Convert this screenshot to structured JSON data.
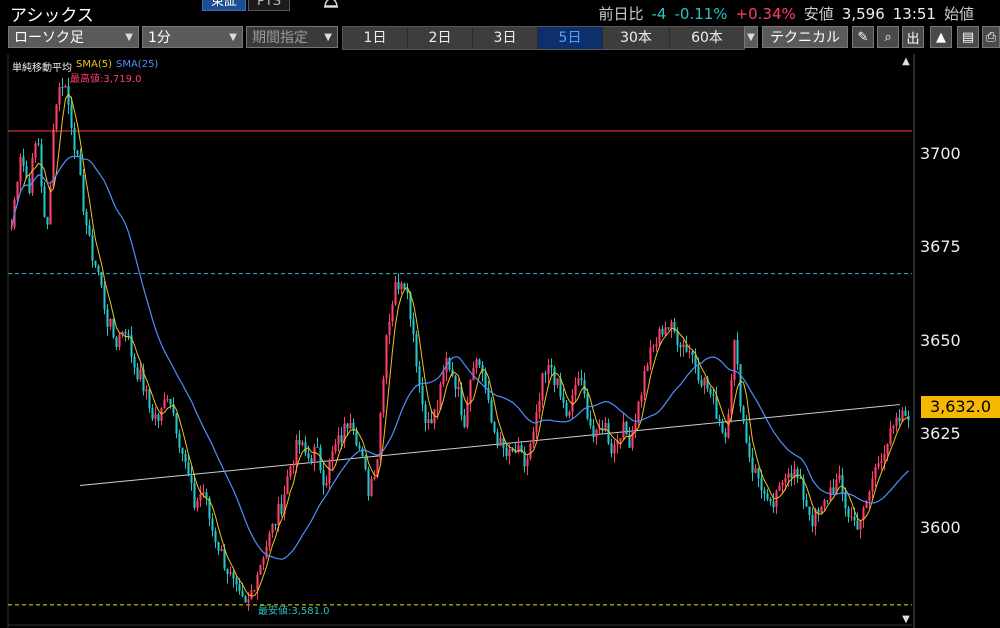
{
  "header": {
    "symbol": "アシックス",
    "exchange_tabs": [
      "東証",
      "PTS"
    ],
    "quote": {
      "change_label": "前日比",
      "change": "-4",
      "change_pct": "-0.11%",
      "high_pct": "+0.34%",
      "low_label": "安値",
      "low_value": "3,596",
      "time": "13:51",
      "open_label": "始値"
    }
  },
  "toolbar": {
    "chart_type": "ローソク足",
    "interval": "1分",
    "period_select": "期間指定",
    "periods": [
      "1日",
      "2日",
      "3日",
      "5日",
      "30本",
      "60本"
    ],
    "active_period": "5日",
    "technical": "テクニカル",
    "tools": [
      {
        "name": "draw-icon",
        "glyph": "✎"
      },
      {
        "name": "zoom-icon",
        "glyph": "⌕"
      },
      {
        "name": "volume-icon",
        "glyph": "出"
      },
      {
        "name": "area-chart-icon",
        "glyph": "▲"
      },
      {
        "name": "save-icon",
        "glyph": "▤"
      },
      {
        "name": "print-icon",
        "glyph": "⎙"
      }
    ]
  },
  "chart": {
    "legend": {
      "title": "単純移動平均",
      "sma5": "SMA(5)",
      "sma25": "SMA(25)"
    },
    "y_ticks": [
      "3700",
      "3675",
      "3650",
      "3625",
      "3600"
    ],
    "current_price": "3,632.0",
    "max_label": "最高値:3,719.0",
    "min_label": "最安値:3,581.0",
    "colors": {
      "up": "#ff3f6b",
      "down": "#27c4c4",
      "sma5": "#f0c419",
      "sma25": "#4f8fff",
      "high_line": "#ff3b3b",
      "dash_line": "#2fb7c7",
      "low_dash": "#f5e200",
      "price_tag": "#f5b800"
    }
  },
  "chart_data": {
    "type": "line",
    "ylim": [
      3576,
      3725
    ],
    "reference_lines": {
      "upper_solid": 3705,
      "upper_dash": 3668,
      "lower_dash": 3582
    },
    "trendline": {
      "start": 3613,
      "end": 3634
    },
    "close_path": [
      3680,
      3700,
      3690,
      3705,
      3675,
      3712,
      3719,
      3706,
      3690,
      3675,
      3668,
      3656,
      3650,
      3655,
      3645,
      3640,
      3632,
      3630,
      3638,
      3628,
      3618,
      3608,
      3612,
      3602,
      3596,
      3590,
      3584,
      3581,
      3589,
      3596,
      3602,
      3608,
      3618,
      3624,
      3620,
      3622,
      3614,
      3622,
      3626,
      3632,
      3622,
      3612,
      3620,
      3652,
      3664,
      3668,
      3656,
      3636,
      3628,
      3634,
      3646,
      3640,
      3630,
      3646,
      3644,
      3630,
      3624,
      3620,
      3622,
      3618,
      3626,
      3640,
      3644,
      3636,
      3630,
      3642,
      3634,
      3624,
      3630,
      3622,
      3628,
      3625,
      3634,
      3645,
      3650,
      3655,
      3653,
      3650,
      3648,
      3642,
      3638,
      3632,
      3626,
      3650,
      3630,
      3618,
      3614,
      3606,
      3610,
      3618,
      3616,
      3610,
      3604,
      3606,
      3612,
      3614,
      3606,
      3603,
      3606,
      3616,
      3622,
      3626,
      3630,
      3632
    ]
  }
}
